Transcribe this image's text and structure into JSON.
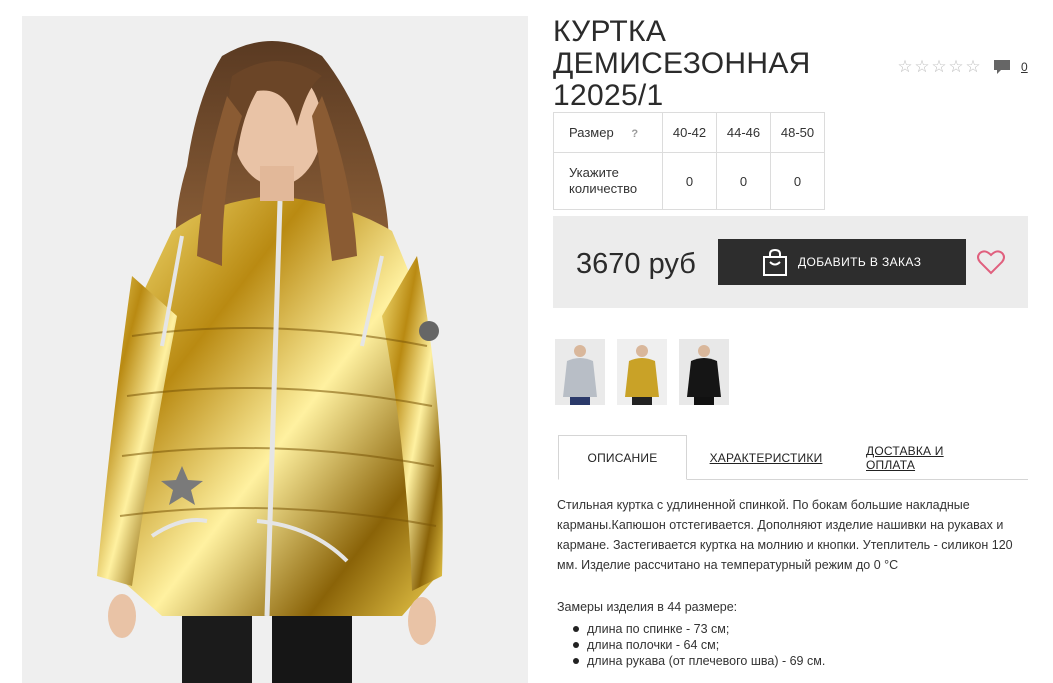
{
  "product": {
    "title_line1": "КУРТКА ДЕМИСЕЗОННАЯ",
    "title_line2": "12025/1",
    "rating_stars": 0,
    "comments_count": "0",
    "price": "3670 руб",
    "add_button_label": "ДОБАВИТЬ В ЗАКАЗ"
  },
  "size_table": {
    "size_label": "Размер",
    "help_mark": "?",
    "sizes": [
      "40-42",
      "44-46",
      "48-50"
    ],
    "qty_label": "Укажите количество",
    "quantities": [
      "0",
      "0",
      "0"
    ]
  },
  "thumbnails": [
    {
      "color": "silver"
    },
    {
      "color": "gold"
    },
    {
      "color": "black"
    }
  ],
  "tabs": [
    {
      "label": "ОПИСАНИЕ",
      "active": true
    },
    {
      "label": "ХАРАКТЕРИСТИКИ",
      "active": false
    },
    {
      "label": "ДОСТАВКА И ОПЛАТА",
      "active": false
    }
  ],
  "description": {
    "text": "Стильная куртка с удлиненной спинкой. По бокам большие накладные карманы.Капюшон отстегивается. Дополняют изделие нашивки на рукавах и кармане. Застегивается куртка на молнию и кнопки. Утеплитель - силикон 120 мм. Изделие рассчитано на температурный режим до 0 °С",
    "measures_title": "Замеры изделия в 44 размере:",
    "measures": [
      "длина по спинке - 73 см;",
      "длина полочки - 64 см;",
      "длина рукава (от плечевого шва) - 69 см."
    ]
  },
  "colors": {
    "button_bg": "#2d2d2d",
    "price_box_bg": "#ececec",
    "heart": "#e0607e",
    "jacket_gold": "#c9a227"
  }
}
